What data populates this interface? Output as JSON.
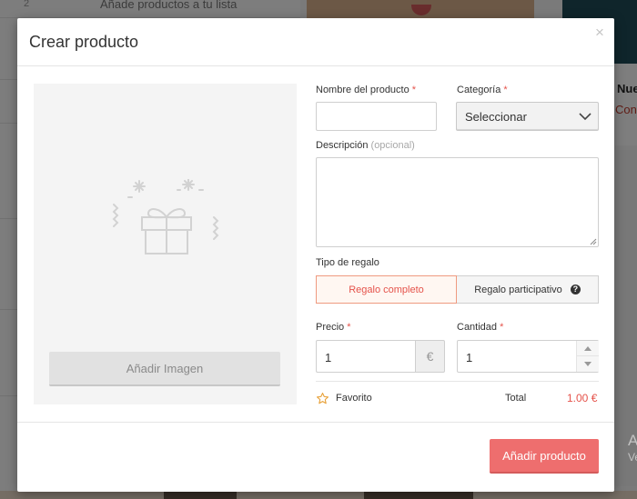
{
  "background": {
    "list_step": "2",
    "list_text": "Añade productos a tu lista",
    "card_title": "Nue",
    "card_link": "Cont"
  },
  "os_watermark": {
    "line1": "Activ",
    "line2": "Ve a C"
  },
  "modal": {
    "title": "Crear producto",
    "close_symbol": "×",
    "image_panel": {
      "add_image_label": "Añadir Imagen",
      "illustration_icon": "gift-icon"
    },
    "form": {
      "name": {
        "label": "Nombre del producto",
        "required": "*",
        "value": ""
      },
      "category": {
        "label": "Categoría",
        "required": "*",
        "selected": "Seleccionar"
      },
      "description": {
        "label": "Descripción",
        "optional": "(opcional)",
        "value": ""
      },
      "gift_type": {
        "label": "Tipo de regalo",
        "options": [
          "Regalo completo",
          "Regalo participativo"
        ],
        "selected": "Regalo completo"
      },
      "price": {
        "label": "Precio",
        "required": "*",
        "value": "1",
        "currency": "€"
      },
      "quantity": {
        "label": "Cantidad",
        "required": "*",
        "value": "1"
      },
      "favorite_label": "Favorito",
      "total_label": "Total",
      "total_value": "1.00 €"
    },
    "submit_label": "Añadir producto"
  },
  "colors": {
    "accent": "#e5534b",
    "button": "#ee6e6e",
    "overlay": "#000000"
  }
}
